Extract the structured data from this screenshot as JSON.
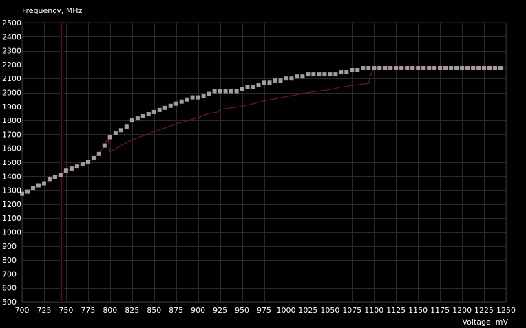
{
  "chart_data": {
    "type": "line",
    "title": "",
    "ylabel": "Frequency, MHz",
    "xlabel": "Voltage, mV",
    "xlim": [
      700,
      1250
    ],
    "ylim": [
      500,
      2500
    ],
    "xticks": [
      700,
      725,
      750,
      775,
      800,
      825,
      850,
      875,
      900,
      925,
      950,
      975,
      1000,
      1025,
      1050,
      1075,
      1100,
      1125,
      1150,
      1175,
      1200,
      1225,
      1250
    ],
    "yticks": [
      500,
      600,
      700,
      800,
      900,
      1000,
      1100,
      1200,
      1300,
      1400,
      1500,
      1600,
      1700,
      1800,
      1900,
      2000,
      2100,
      2200,
      2300,
      2400,
      2500
    ],
    "grid": true,
    "marker_voltage": 745,
    "series": [
      {
        "role": "curve",
        "color": "#a39d9d",
        "style": "square-markers",
        "x": [
          700,
          706.25,
          712.5,
          718.75,
          725,
          731.25,
          737.5,
          743.75,
          750,
          756.25,
          762.5,
          768.75,
          775,
          781.25,
          787.5,
          793.75,
          800,
          806.25,
          812.5,
          818.75,
          825,
          831.25,
          837.5,
          843.75,
          850,
          856.25,
          862.5,
          868.75,
          875,
          881.25,
          887.5,
          893.75,
          900,
          906.25,
          912.5,
          918.75,
          925,
          931.25,
          937.5,
          943.75,
          950,
          956.25,
          962.5,
          968.75,
          975,
          981.25,
          987.5,
          993.75,
          1000,
          1006.25,
          1012.5,
          1018.75,
          1025,
          1031.25,
          1037.5,
          1043.75,
          1050,
          1056.25,
          1062.5,
          1068.75,
          1075,
          1081.25,
          1087.5,
          1093.75,
          1100,
          1106.25,
          1112.5,
          1118.75,
          1125,
          1131.25,
          1137.5,
          1143.75,
          1150,
          1156.25,
          1162.5,
          1168.75,
          1175,
          1181.25,
          1187.5,
          1193.75,
          1200,
          1206.25,
          1212.5,
          1218.75,
          1225,
          1231.25,
          1237.5,
          1243.75
        ],
        "y": [
          1275,
          1290,
          1315,
          1335,
          1350,
          1380,
          1395,
          1410,
          1440,
          1455,
          1470,
          1485,
          1500,
          1530,
          1560,
          1620,
          1680,
          1710,
          1730,
          1755,
          1800,
          1815,
          1830,
          1845,
          1860,
          1875,
          1890,
          1905,
          1920,
          1935,
          1950,
          1965,
          1965,
          1975,
          1990,
          2010,
          2010,
          2010,
          2010,
          2010,
          2025,
          2040,
          2040,
          2055,
          2070,
          2070,
          2085,
          2085,
          2100,
          2100,
          2115,
          2115,
          2130,
          2130,
          2130,
          2130,
          2130,
          2130,
          2145,
          2145,
          2160,
          2160,
          2175,
          2175,
          2175,
          2175,
          2175,
          2175,
          2175,
          2175,
          2175,
          2175,
          2175,
          2175,
          2175,
          2175,
          2175,
          2175,
          2175,
          2175,
          2175,
          2175,
          2175,
          2175,
          2175,
          2175,
          2175,
          2175
        ]
      },
      {
        "role": "default-curve",
        "color": "#8b1a1a",
        "style": "line",
        "x": [
          700,
          725,
          750,
          775,
          787.5,
          793.75,
          797.5,
          800,
          812.5,
          825,
          850,
          875,
          900,
          912.5,
          922.5,
          925,
          937.5,
          950,
          975,
          1000,
          1025,
          1050,
          1062.5,
          1065,
          1075,
          1087.5,
          1093.75,
          1096.25,
          1100,
          1125,
          1150,
          1175,
          1200,
          1225,
          1250
        ],
        "y": [
          1275,
          1350,
          1440,
          1500,
          1560,
          1620,
          1680,
          1575,
          1620,
          1660,
          1720,
          1775,
          1820,
          1850,
          1860,
          1880,
          1890,
          1900,
          1940,
          1970,
          2000,
          2020,
          2040,
          2040,
          2050,
          2060,
          2065,
          2130,
          2175,
          2175,
          2175,
          2175,
          2175,
          2175,
          2170
        ]
      }
    ]
  }
}
